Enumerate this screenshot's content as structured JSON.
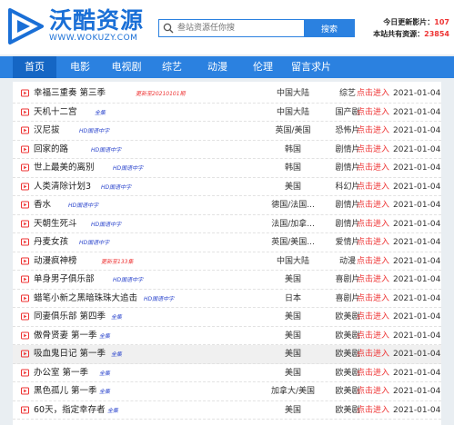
{
  "site": {
    "title": "沃酷资源",
    "url": "WWW.WOKUZY.COM"
  },
  "search": {
    "placeholder": "叁站资源任你搜",
    "button": "搜索"
  },
  "stats": {
    "today_label": "今日更新影片：",
    "today_value": "107",
    "total_label": "本站共有资源：",
    "total_value": "23854"
  },
  "nav": {
    "items": [
      "首页",
      "电影",
      "电视剧",
      "综艺",
      "动漫",
      "伦理",
      "留言求片"
    ],
    "active": "首页"
  },
  "colors": {
    "accent": "#2b81e0",
    "link": "#e33333",
    "tag": "#2a44cc"
  },
  "list": {
    "rows": [
      {
        "title": "幸福三重奏 第三季",
        "tag": "更新至20210101期",
        "tag_color": "red",
        "region": "中国大陆",
        "genre": "综艺",
        "link": "点击进入",
        "date": "2021-01-04"
      },
      {
        "title": "天机十二宫",
        "tag": "全集",
        "tag_color": "blue",
        "region": "中国大陆",
        "genre": "国产剧",
        "link": "点击进入",
        "date": "2021-01-04"
      },
      {
        "title": "汉尼拔",
        "tag": "HD国语中字",
        "tag_color": "blue",
        "region": "英国/美国",
        "genre": "恐怖片",
        "link": "点击进入",
        "date": "2021-01-04"
      },
      {
        "title": "回家的路",
        "tag": "HD国语中字",
        "tag_color": "blue",
        "region": "韩国",
        "genre": "剧情片",
        "link": "点击进入",
        "date": "2021-01-04"
      },
      {
        "title": "世上最美的离别",
        "tag": "HD国语中字",
        "tag_color": "blue",
        "region": "韩国",
        "genre": "剧情片",
        "link": "点击进入",
        "date": "2021-01-04"
      },
      {
        "title": "人类清除计划3",
        "tag": "HD国语中字",
        "tag_color": "blue",
        "region": "美国",
        "genre": "科幻片",
        "link": "点击进入",
        "date": "2021-01-04"
      },
      {
        "title": "香水",
        "tag": "HD国语中字",
        "tag_color": "blue",
        "region": "德国/法国...",
        "genre": "剧情片",
        "link": "点击进入",
        "date": "2021-01-04"
      },
      {
        "title": "天朝生死斗",
        "tag": "HD国语中字",
        "tag_color": "blue",
        "region": "法国/加拿...",
        "genre": "剧情片",
        "link": "点击进入",
        "date": "2021-01-04"
      },
      {
        "title": "丹麦女孩",
        "tag": "HD国语中字",
        "tag_color": "blue",
        "region": "英国/美国...",
        "genre": "爱情片",
        "link": "点击进入",
        "date": "2021-01-04"
      },
      {
        "title": "动漫疯神榜",
        "tag": "更新至133集",
        "tag_color": "red",
        "region": "中国大陆",
        "genre": "动漫",
        "link": "点击进入",
        "date": "2021-01-04"
      },
      {
        "title": "单身男子俱乐部",
        "tag": "HD国语中字",
        "tag_color": "blue",
        "region": "美国",
        "genre": "喜剧片",
        "link": "点击进入",
        "date": "2021-01-04"
      },
      {
        "title": "蜡笔小新之黑暗珠珠大追击",
        "tag": "HD国语中字",
        "tag_color": "blue",
        "region": "日本",
        "genre": "喜剧片",
        "link": "点击进入",
        "date": "2021-01-04"
      },
      {
        "title": "同妻俱乐部 第四季",
        "tag": "全集",
        "tag_color": "blue",
        "region": "美国",
        "genre": "欧美剧",
        "link": "点击进入",
        "date": "2021-01-04"
      },
      {
        "title": "傲骨贤妻 第一季",
        "tag": "全集",
        "tag_color": "blue",
        "region": "美国",
        "genre": "欧美剧",
        "link": "点击进入",
        "date": "2021-01-04"
      },
      {
        "title": "吸血鬼日记 第一季",
        "tag": "全集",
        "tag_color": "blue",
        "region": "美国",
        "genre": "欧美剧",
        "link": "点击进入",
        "date": "2021-01-04"
      },
      {
        "title": "办公室 第一季",
        "tag": "全集",
        "tag_color": "blue",
        "region": "美国",
        "genre": "欧美剧",
        "link": "点击进入",
        "date": "2021-01-04"
      },
      {
        "title": "黑色孤儿 第一季",
        "tag": "全集",
        "tag_color": "blue",
        "region": "加拿大/美国",
        "genre": "欧美剧",
        "link": "点击进入",
        "date": "2021-01-04"
      },
      {
        "title": "60天，指定幸存者",
        "tag": "全集",
        "tag_color": "blue",
        "region": "美国",
        "genre": "欧美剧",
        "link": "点击进入",
        "date": "2021-01-04"
      }
    ]
  }
}
